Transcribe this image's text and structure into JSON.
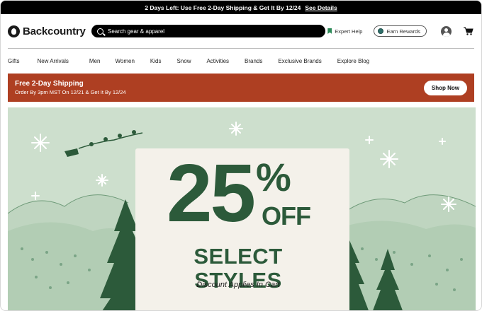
{
  "announcement": {
    "text": "2 Days Left: Use Free 2-Day Shipping & Get It By 12/24",
    "link": "See Details"
  },
  "header": {
    "logo_text": "Backcountry",
    "search_placeholder": "Search gear & apparel",
    "expert_help": "Expert Help",
    "earn_rewards": "Earn Rewards",
    "icons": [
      "backcountry-logo-icon",
      "search-icon",
      "bookmark-icon",
      "rewards-coin-icon",
      "account-icon",
      "cart-icon"
    ]
  },
  "nav": {
    "items": [
      "Gifts",
      "New Arrivals",
      "Men",
      "Women",
      "Kids",
      "Snow",
      "Activities",
      "Brands",
      "Exclusive Brands",
      "Explore Blog"
    ]
  },
  "promo": {
    "title": "Free 2-Day Shipping",
    "subtitle": "Order By 3pm MST On 12/21 & Get It By 12/24",
    "button": "Shop Now",
    "color": "#ae3f22"
  },
  "hero": {
    "number": "25",
    "percent": "%",
    "off": "OFF",
    "headline": "SELECT STYLES",
    "disclaimer": "Discount Applies In Cart",
    "background_color": "#cddfcd",
    "text_color": "#2c5a3a"
  }
}
